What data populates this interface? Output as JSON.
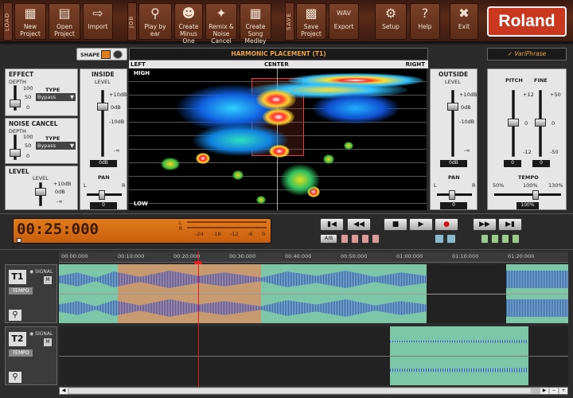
{
  "toolbar": {
    "sections": [
      "LOAD",
      "JOB",
      "SAVE"
    ],
    "buttons": [
      {
        "label": "New Project",
        "icon": "new-project-icon"
      },
      {
        "label": "Open Project",
        "icon": "open-folder-icon"
      },
      {
        "label": "Import",
        "icon": "import-icon"
      },
      {
        "label": "Play by ear",
        "icon": "magnifier-icon"
      },
      {
        "label": "Create Minus One",
        "icon": "person-icon"
      },
      {
        "label": "Remix & Noise Cancel",
        "icon": "broom-icon"
      },
      {
        "label": "Create Song Medley",
        "icon": "grid-icon"
      },
      {
        "label": "Save Project",
        "icon": "save-icon"
      },
      {
        "label": "Export",
        "icon": "wav-export-icon"
      },
      {
        "label": "Setup",
        "icon": "gear-icon"
      },
      {
        "label": "Help",
        "icon": "help-icon"
      },
      {
        "label": "Exit",
        "icon": "close-icon"
      }
    ],
    "wav_badge": "WAV",
    "brand": "Roland"
  },
  "effect": {
    "title": "EFFECT",
    "depth": "DEPTH",
    "type": "TYPE",
    "type_value": "Bypass",
    "scale": [
      "100",
      "50",
      "0"
    ]
  },
  "noise": {
    "title": "NOISE CANCEL",
    "depth": "DEPTH",
    "type": "TYPE",
    "type_value": "Bypass",
    "scale": [
      "100",
      "50",
      "0"
    ]
  },
  "level": {
    "title": "LEVEL",
    "sub": "LEVEL",
    "scale": [
      "+10dB",
      "0dB",
      "-∞"
    ]
  },
  "shape": {
    "label": "SHAPE"
  },
  "inside": {
    "title": "INSIDE",
    "level": "LEVEL",
    "scale": [
      "+10dB",
      "0dB",
      "-10dB",
      "-∞"
    ],
    "value": "0dB",
    "pan": "PAN",
    "pan_l": "L",
    "pan_r": "R",
    "pan_value": "0"
  },
  "harmonic": {
    "title": "HARMONIC PLACEMENT (T1)",
    "left": "LEFT",
    "center": "CENTER",
    "right": "RIGHT",
    "high": "HIGH",
    "low": "LOW"
  },
  "outside": {
    "title": "OUTSIDE",
    "level": "LEVEL",
    "scale": [
      "+10dB",
      "0dB",
      "-10dB",
      "-∞"
    ],
    "value": "0dB",
    "pan": "PAN",
    "pan_l": "L",
    "pan_r": "R",
    "pan_value": "0"
  },
  "variphrase": {
    "title": "VariPhrase",
    "pitch": "PITCH",
    "fine": "FINE",
    "pitch_scale": [
      "+12",
      "0",
      "-12"
    ],
    "fine_scale": [
      "+50",
      "0",
      "-50"
    ],
    "pitch_value": "0",
    "fine_value": "0",
    "tempo": "TEMPO",
    "tempo_scale": [
      "50%",
      "100%",
      "130%"
    ],
    "tempo_value": "100%"
  },
  "transport": {
    "time": "00:25:000",
    "meter_l": "L",
    "meter_r": "R",
    "meter_scale": [
      "-24",
      "-18",
      "-12",
      "-6",
      "0"
    ],
    "ab": "A/B"
  },
  "timeline": {
    "ticks": [
      "00:00:000",
      "00:10:000",
      "00:20:000",
      "00:30:000",
      "00:40:000",
      "00:50:000",
      "01:00:000",
      "01:10:000",
      "01:20:000"
    ]
  },
  "tracks": [
    {
      "id": "T1",
      "signal": "SIGNAL",
      "m": "M",
      "tempo": "TEMPO"
    },
    {
      "id": "T2",
      "signal": "SIGNAL",
      "m": "M",
      "tempo": "TEMPO"
    }
  ],
  "colors": {
    "accent": "#e07c1c",
    "brand": "#c9381e",
    "wave": "#3a4fd0",
    "region": "#7ec6a8",
    "selection": "#c89a70"
  }
}
